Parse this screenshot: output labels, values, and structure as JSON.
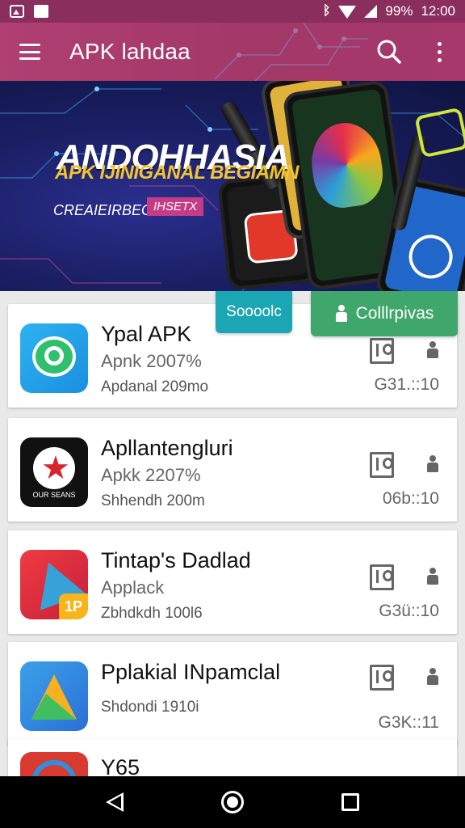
{
  "status_bar": {
    "battery": "99%",
    "time": "12:00"
  },
  "app_bar": {
    "title": "APK lahdaa"
  },
  "banner": {
    "headline": "ANDOHHASIA",
    "subheadline": "APK IJINIGANAL BEGIAMN",
    "tagline": "CREAIEIRBEGBI",
    "tag_badge": "IHSETX"
  },
  "buttons": {
    "teal_label": "Soooolc",
    "green_label": "Colllrpivas"
  },
  "apps": [
    {
      "name": "Ypal APK",
      "line2": "Apnk 2007%",
      "line3": "Apdanal 209mo",
      "right": "G31.::10"
    },
    {
      "name": "Apllantengluri",
      "line2": "Apkk 2207%",
      "line3": "Shhendh 200m",
      "right": "06b::10"
    },
    {
      "name": "Tintap's Dadlad",
      "line2": "Applack",
      "line3": "Zbhdkdh 100l6",
      "right": "G3ü::10"
    },
    {
      "name": "Pplakial INpamclal",
      "line2": "",
      "line3": "Shdondi 1910i",
      "right": "G3K::11"
    },
    {
      "name": "Y65",
      "line2": "",
      "line3": "",
      "right": ""
    }
  ],
  "icons": {
    "app1_label": "",
    "app2_label": "OUR SEANS",
    "app3_label": "1P"
  }
}
